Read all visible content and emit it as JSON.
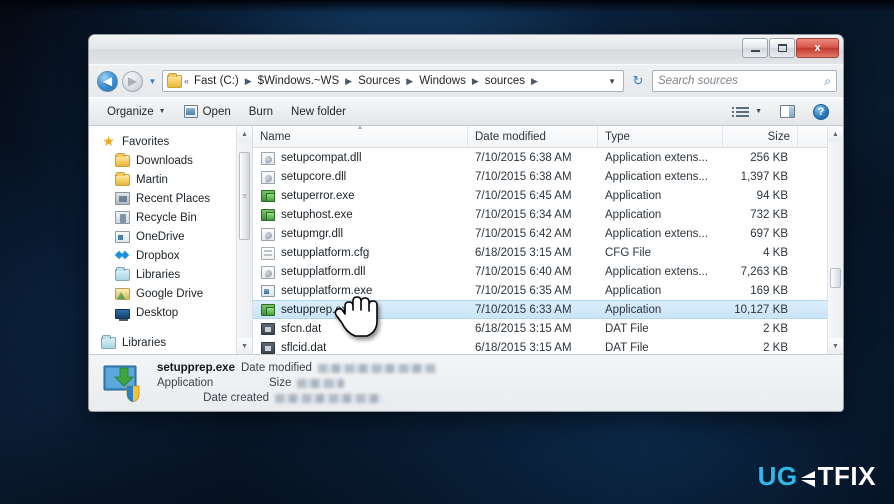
{
  "desktop": {
    "watermark_part1": "UG",
    "watermark_e": "E",
    "watermark_part2": "TFIX"
  },
  "window": {
    "titlebar": {
      "minimize_label": "Minimize",
      "maximize_label": "Maximize",
      "close_label": "x"
    },
    "navbar": {
      "back_label": "◀",
      "forward_label": "▶",
      "history_caret": "▼",
      "breadcrumb_overflow": "«",
      "breadcrumbs": [
        "Fast (C:)",
        "$Windows.~WS",
        "Sources",
        "Windows",
        "sources"
      ],
      "breadcrumb_separator": "▶",
      "address_dropdown": "▼",
      "refresh_label": "↻",
      "search_placeholder": "Search sources",
      "search_value": "",
      "search_icon": "⌕"
    },
    "cmdbar": {
      "organize_label": "Organize",
      "organize_caret": "▼",
      "open_label": "Open",
      "burn_label": "Burn",
      "new_folder_label": "New folder",
      "view_caret": "▼",
      "help_label": "?"
    }
  },
  "sidebar": {
    "items": [
      {
        "label": "Favorites",
        "icon": "star",
        "level": 0
      },
      {
        "label": "Downloads",
        "icon": "folder",
        "level": 1
      },
      {
        "label": "Martin",
        "icon": "folder",
        "level": 1
      },
      {
        "label": "Recent Places",
        "icon": "recent",
        "level": 1
      },
      {
        "label": "Recycle Bin",
        "icon": "recycle",
        "level": 1
      },
      {
        "label": "OneDrive",
        "icon": "onedrive",
        "level": 1
      },
      {
        "label": "Dropbox",
        "icon": "dropbox",
        "level": 1
      },
      {
        "label": "Libraries",
        "icon": "libs",
        "level": 1
      },
      {
        "label": "Google Drive",
        "icon": "gfolder",
        "level": 1
      },
      {
        "label": "Desktop",
        "icon": "desktop",
        "level": 1
      },
      {
        "label": "",
        "icon": "spacer",
        "level": 0
      },
      {
        "label": "Libraries",
        "icon": "libs",
        "level": 0
      }
    ],
    "scroll_up": "▲",
    "scroll_down": "▼"
  },
  "filelist": {
    "columns": [
      {
        "key": "name",
        "label": "Name",
        "sorted": true
      },
      {
        "key": "date",
        "label": "Date modified",
        "sorted": false
      },
      {
        "key": "type",
        "label": "Type",
        "sorted": false
      },
      {
        "key": "size",
        "label": "Size",
        "sorted": false
      }
    ],
    "rows": [
      {
        "name": "setupcompat.dll",
        "date": "7/10/2015 6:38 AM",
        "type": "Application extens...",
        "size": "256 KB",
        "icon": "dll",
        "selected": false
      },
      {
        "name": "setupcore.dll",
        "date": "7/10/2015 6:38 AM",
        "type": "Application extens...",
        "size": "1,397 KB",
        "icon": "dll",
        "selected": false
      },
      {
        "name": "setuperror.exe",
        "date": "7/10/2015 6:45 AM",
        "type": "Application",
        "size": "94 KB",
        "icon": "exe",
        "selected": false
      },
      {
        "name": "setuphost.exe",
        "date": "7/10/2015 6:34 AM",
        "type": "Application",
        "size": "732 KB",
        "icon": "exe",
        "selected": false
      },
      {
        "name": "setupmgr.dll",
        "date": "7/10/2015 6:42 AM",
        "type": "Application extens...",
        "size": "697 KB",
        "icon": "dll",
        "selected": false
      },
      {
        "name": "setupplatform.cfg",
        "date": "6/18/2015 3:15 AM",
        "type": "CFG File",
        "size": "4 KB",
        "icon": "cfg",
        "selected": false
      },
      {
        "name": "setupplatform.dll",
        "date": "7/10/2015 6:40 AM",
        "type": "Application extens...",
        "size": "7,263 KB",
        "icon": "dll",
        "selected": false
      },
      {
        "name": "setupplatform.exe",
        "date": "7/10/2015 6:35 AM",
        "type": "Application",
        "size": "169 KB",
        "icon": "exeblue",
        "selected": false
      },
      {
        "name": "setupprep.exe",
        "date": "7/10/2015 6:33 AM",
        "type": "Application",
        "size": "10,127 KB",
        "icon": "exe",
        "selected": true
      },
      {
        "name": "sfcn.dat",
        "date": "6/18/2015 3:15 AM",
        "type": "DAT File",
        "size": "2 KB",
        "icon": "dat",
        "selected": false
      },
      {
        "name": "sflcid.dat",
        "date": "6/18/2015 3:15 AM",
        "type": "DAT File",
        "size": "2 KB",
        "icon": "dat",
        "selected": false
      }
    ]
  },
  "details": {
    "file_name": "setupprep.exe",
    "file_type": "Application",
    "date_modified_label": "Date modified",
    "size_label": "Size",
    "date_created_label": "Date created",
    "date_modified_value": "",
    "size_value": "",
    "date_created_value": ""
  },
  "colors": {
    "selection": "#c9e4f8",
    "accent": "#2f7fc4",
    "close_button": "#c2382c",
    "watermark_cyan": "#2fb7e8"
  }
}
